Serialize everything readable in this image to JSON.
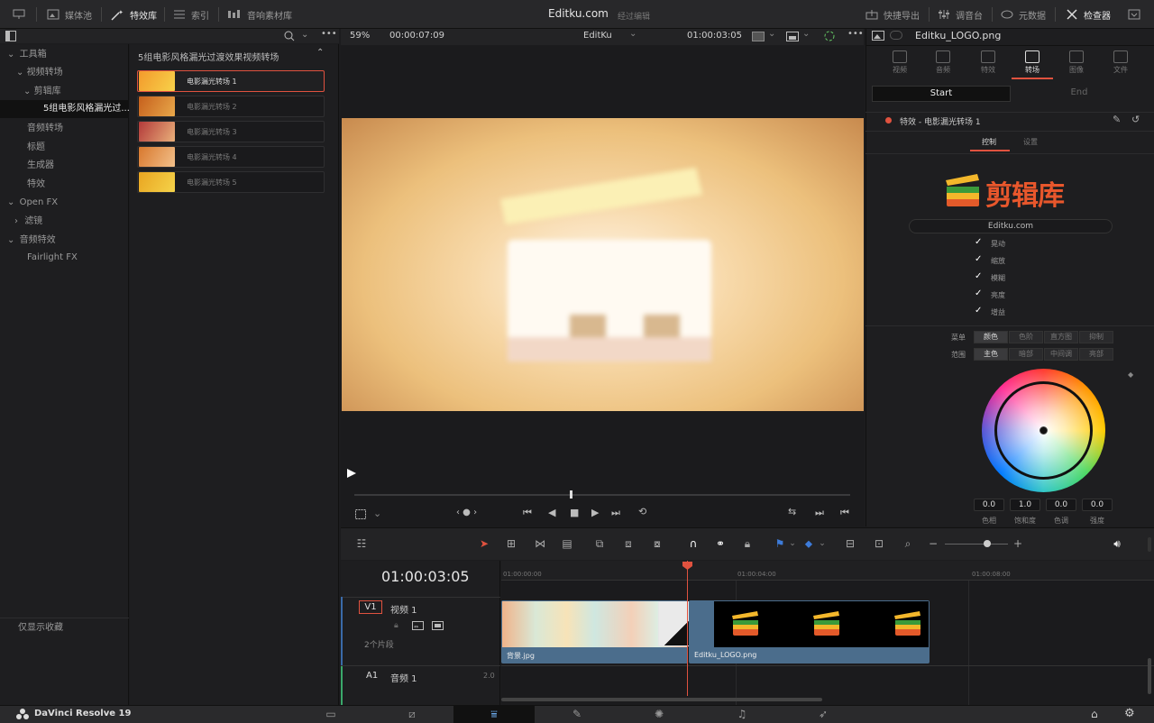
{
  "topbar": {
    "media_pool": "媒体池",
    "effects": "特效库",
    "index": "索引",
    "sound_library": "音响素材库",
    "project_title": "Editku.com",
    "project_status": "经过编辑",
    "quick_export": "快捷导出",
    "mixer": "调音台",
    "metadata": "元数据",
    "inspector": "检查器"
  },
  "effects_tree": {
    "toolbox": "工具箱",
    "video_transitions": "视频转场",
    "clip_library": "剪辑库",
    "selected_pack": "5组电影风格漏光过...",
    "audio_transitions": "音频转场",
    "titles": "标题",
    "generators": "生成器",
    "effects": "特效",
    "open_fx": "Open FX",
    "filters": "滤镜",
    "audio_fx": "音频特效",
    "fairlight_fx": "Fairlight FX",
    "favorites": "仅显示收藏"
  },
  "effects_list": {
    "header": "5组电影风格漏光过渡效果视频转场",
    "items": [
      {
        "label": "电影漏光转场 1",
        "color_a": "#f39a2c",
        "color_b": "#f7d24a"
      },
      {
        "label": "电影漏光转场 2",
        "color_a": "#c6601d",
        "color_b": "#e8a84a"
      },
      {
        "label": "电影漏光转场 3",
        "color_a": "#b33a3a",
        "color_b": "#e9b07a"
      },
      {
        "label": "电影漏光转场 4",
        "color_a": "#d8782e",
        "color_b": "#f2c08a"
      },
      {
        "label": "电影漏光转场 5",
        "color_a": "#e9a521",
        "color_b": "#f5d34a"
      }
    ]
  },
  "viewer": {
    "zoom": "59%",
    "duration": "00:00:07:09",
    "timeline_name": "EditKu",
    "timecode": "01:00:03:05"
  },
  "inspector": {
    "filename": "Editku_LOGO.png",
    "tabs": [
      "视频",
      "音频",
      "特效",
      "转场",
      "图像",
      "文件"
    ],
    "active_tab": "转场",
    "start": "Start",
    "end": "End",
    "effect_title": "特效 - 电影漏光转场 1",
    "sub_tabs": [
      "控制",
      "设置"
    ],
    "logo_text": "剪辑库",
    "site": "Editku.com",
    "checkboxes": [
      "晃动",
      "缩放",
      "模糊",
      "亮度",
      "增益"
    ],
    "row1_label": "菜单",
    "row1_options": [
      "颜色",
      "色阶",
      "直方图",
      "抑制"
    ],
    "row2_label": "范围",
    "row2_options": [
      "主色",
      "暗部",
      "中间调",
      "亮部"
    ],
    "wheel_values": [
      "0.0",
      "1.0",
      "0.0",
      "0.0"
    ],
    "wheel_labels": [
      "色相",
      "饱和度",
      "色调",
      "强度"
    ]
  },
  "timeline": {
    "timecode": "01:00:03:05",
    "ruler": [
      "01:00:00:00",
      "01:00:04:00",
      "01:00:08:00"
    ],
    "v1_tag": "V1",
    "v1_name": "视频 1",
    "v1_count": "2个片段",
    "a1_tag": "A1",
    "a1_name": "音频 1",
    "a1_level": "2.0",
    "clip1": "背景.jpg",
    "clip2": "Editku_LOGO.png"
  },
  "footer": {
    "brand": "DaVinci Resolve 19"
  },
  "colors": {
    "accent_red": "#e0523f",
    "clip_blue": "#4b6d8c",
    "playhead": "#e0523f"
  }
}
